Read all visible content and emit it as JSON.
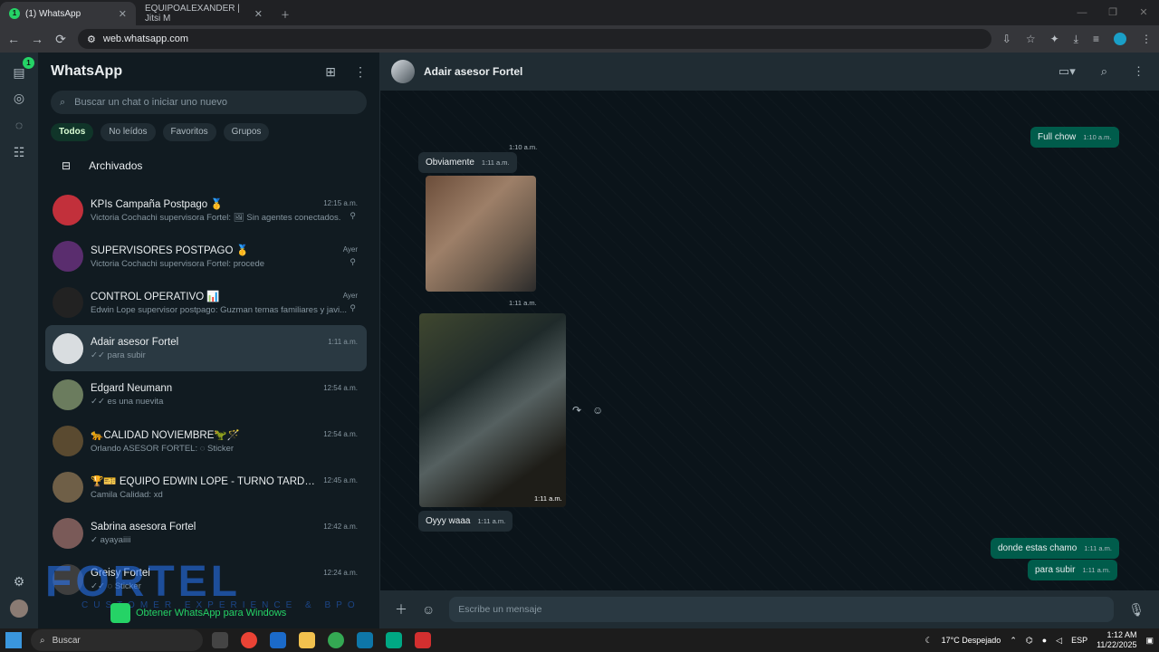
{
  "browser": {
    "tabs": [
      {
        "title": "(1) WhatsApp",
        "badge": "1"
      },
      {
        "title": "EQUIPOALEXANDER | Jitsi M"
      }
    ],
    "url": "web.whatsapp.com"
  },
  "rail": {
    "badge": "1"
  },
  "sidebar": {
    "title": "WhatsApp",
    "search_placeholder": "Buscar un chat o iniciar uno nuevo",
    "filters": [
      "Todos",
      "No leídos",
      "Favoritos",
      "Grupos"
    ],
    "archived": "Archivados",
    "chats": [
      {
        "name": "KPIs Campaña Postpago 🥇",
        "time": "12:15 a.m.",
        "preview": "Victoria Cochachi supervisora Fortel: 🖼 Sin agentes conectados.",
        "pinned": true,
        "color": "#c2303b"
      },
      {
        "name": "SUPERVISORES POSTPAGO 🥇",
        "time": "Ayer",
        "preview": "Victoria Cochachi supervisora Fortel: procede",
        "pinned": true,
        "color": "#5a2d6e"
      },
      {
        "name": "CONTROL OPERATIVO 📊",
        "time": "Ayer",
        "preview": "Edwin Lope supervisor postpago: Guzman temas familiares y javi...",
        "pinned": true,
        "color": "#222"
      },
      {
        "name": "Adair asesor Fortel",
        "time": "1:11 a.m.",
        "preview": "✓✓ para subir",
        "pinned": false,
        "color": "#d9dde0"
      },
      {
        "name": "Edgard Neumann",
        "time": "12:54 a.m.",
        "preview": "✓✓ es una nuevita",
        "pinned": false,
        "color": "#6b7c5e"
      },
      {
        "name": "🐆CALIDAD NOVIEMBRE🦖🪄",
        "time": "12:54 a.m.",
        "preview": "Orlando ASESOR FORTEL: ◌ Sticker",
        "pinned": false,
        "color": "#5a4a30"
      },
      {
        "name": "🏆🎫 EQUIPO EDWIN LOPE - TURNO TARDE 🐯👻",
        "time": "12:45 a.m.",
        "preview": "Camila Calidad: xd",
        "pinned": false,
        "color": "#6f5f47"
      },
      {
        "name": "Sabrina asesora Fortel",
        "time": "12:42 a.m.",
        "preview": "✓ ayayaiiii",
        "pinned": false,
        "color": "#7a5a58"
      },
      {
        "name": "Greisy Fortel",
        "time": "12:24 a.m.",
        "preview": "✓✓ ◌ Sticker",
        "pinned": false,
        "color": "#3e3e3e"
      }
    ],
    "promo": "Obtener WhatsApp para Windows",
    "watermark": "FORTEL",
    "watermark_sub": "CUSTOMER EXPERIENCE & BPO"
  },
  "chat": {
    "name": "Adair asesor Fortel",
    "messages": {
      "t1": "1:10 a.m.",
      "out1": "Full chow",
      "out1_time": "1:10 a.m.",
      "in1": "Obviamente",
      "in1_time": "1:11 a.m.",
      "t2": "1:11 a.m.",
      "t3": "1:11 a.m.",
      "in2": "Oyyy waaa",
      "in2_time": "1:11 a.m.",
      "out2": "donde estas chamo",
      "out2_time": "1:11 a.m.",
      "out3": "para subir",
      "out3_time": "1:11 a.m."
    },
    "composer_placeholder": "Escribe un mensaje"
  },
  "taskbar": {
    "search": "Buscar",
    "weather": "17°C  Despejado",
    "lang": "ESP",
    "time": "1:12 AM",
    "date": "11/22/2025"
  }
}
